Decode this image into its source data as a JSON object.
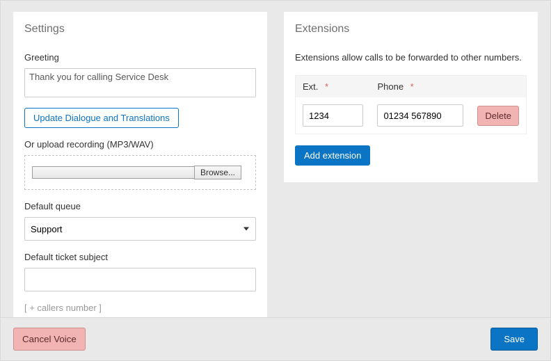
{
  "settings": {
    "heading": "Settings",
    "greeting_label": "Greeting",
    "greeting_value": "Thank you for calling Service Desk",
    "update_button": "Update Dialogue and Translations",
    "upload_label": "Or upload recording (MP3/WAV)",
    "browse_label": "Browse...",
    "default_queue_label": "Default queue",
    "default_queue_value": "Support",
    "ticket_subject_label": "Default ticket subject",
    "ticket_subject_value": "",
    "hint": "[ + callers number ]"
  },
  "extensions": {
    "heading": "Extensions",
    "description": "Extensions allow calls to be forwarded to other numbers.",
    "col_ext": "Ext.",
    "col_phone": "Phone",
    "rows": [
      {
        "ext": "1234",
        "phone": "01234 567890"
      }
    ],
    "delete_label": "Delete",
    "add_label": "Add extension"
  },
  "footer": {
    "cancel": "Cancel Voice",
    "save": "Save"
  }
}
